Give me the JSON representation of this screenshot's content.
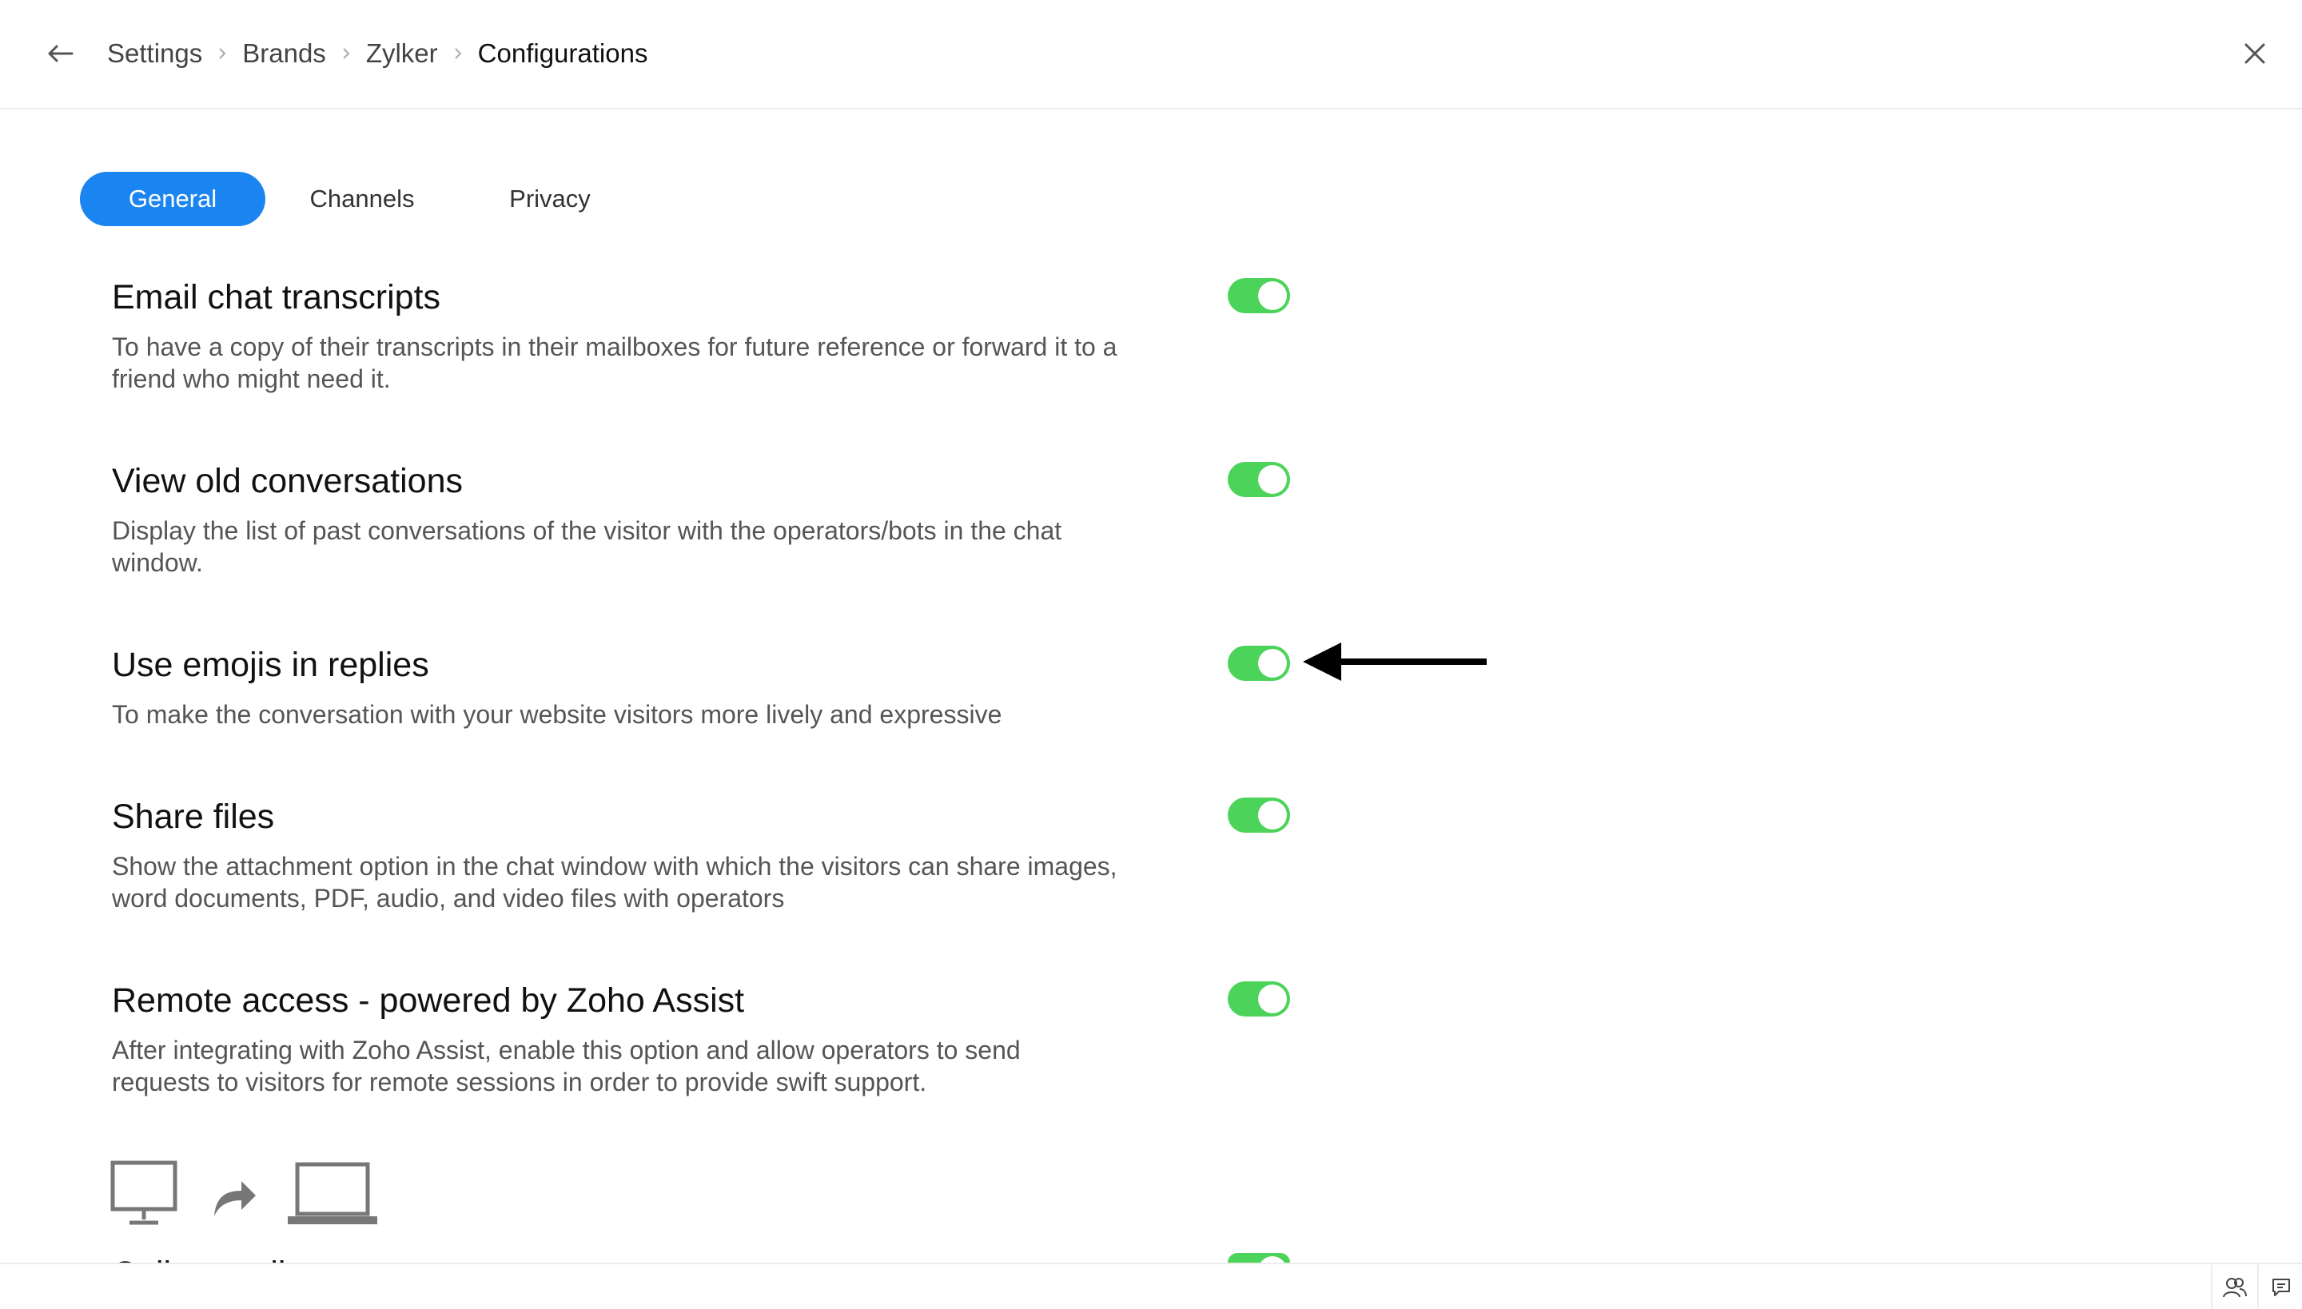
{
  "breadcrumb": {
    "items": [
      "Settings",
      "Brands",
      "Zylker"
    ],
    "current": "Configurations"
  },
  "tabs": {
    "general": "General",
    "channels": "Channels",
    "privacy": "Privacy"
  },
  "settings": [
    {
      "title": "Email chat transcripts",
      "description": "To have a copy of their transcripts in their mailboxes for future reference or forward it to a friend who might need it.",
      "enabled": true
    },
    {
      "title": "View old conversations",
      "description": "Display the list of past conversations of the visitor with the operators/bots in the chat window.",
      "enabled": true
    },
    {
      "title": "Use emojis in replies",
      "description": "To make the conversation with your website visitors more lively and expressive",
      "enabled": true
    },
    {
      "title": "Share files",
      "description": "Show the attachment option in the chat window with which the visitors can share images, word documents, PDF, audio, and video files with operators",
      "enabled": true
    },
    {
      "title": "Remote access - powered by Zoho Assist",
      "description": "After integrating with Zoho Assist, enable this option and allow operators to send requests to visitors for remote sessions in order to provide swift support.",
      "enabled": true
    }
  ],
  "next_setting": {
    "title": "Call recording",
    "enabled": true
  },
  "colors": {
    "accent": "#1a84f0",
    "toggle_on": "#4cd35a"
  },
  "icons": {
    "back": "arrow-left-icon",
    "close": "close-icon",
    "remote": [
      "monitor-icon",
      "share-arrow-icon",
      "laptop-icon"
    ],
    "footer": [
      "operators-icon",
      "chat-icon"
    ]
  }
}
